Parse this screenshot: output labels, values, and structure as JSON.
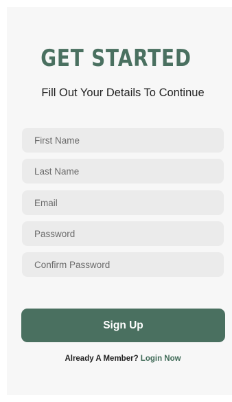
{
  "header": {
    "title": "GET STARTED",
    "subtitle": "Fill Out Your Details To Continue"
  },
  "form": {
    "fields": [
      {
        "placeholder": "First Name",
        "value": ""
      },
      {
        "placeholder": "Last Name",
        "value": ""
      },
      {
        "placeholder": "Email",
        "value": ""
      },
      {
        "placeholder": "Password",
        "value": ""
      },
      {
        "placeholder": "Confirm Password",
        "value": ""
      }
    ],
    "submit_label": "Sign Up"
  },
  "footer": {
    "prompt": "Already A Member?",
    "link_label": "Login Now"
  },
  "colors": {
    "accent": "#4a7060",
    "field_background": "#ebebeb",
    "screen_background": "#f7f7f7"
  }
}
